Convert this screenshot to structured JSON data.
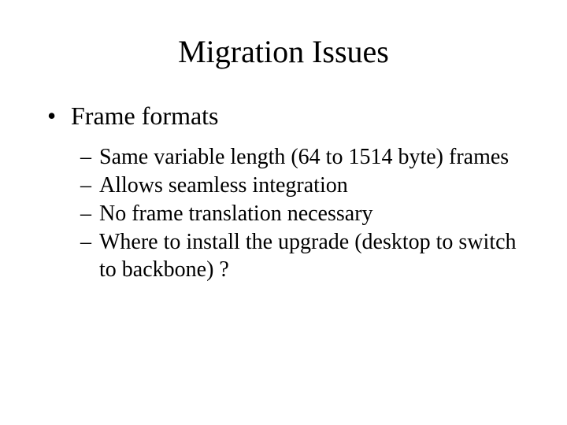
{
  "title": "Migration Issues",
  "bullet_char": "•",
  "dash_char": "–",
  "level1": {
    "item0": "Frame formats"
  },
  "level2": {
    "item0": "Same variable length (64 to 1514 byte) frames",
    "item1": "Allows seamless integration",
    "item2": "No frame translation necessary",
    "item3": "Where to install the upgrade (desktop to switch to backbone) ?"
  }
}
